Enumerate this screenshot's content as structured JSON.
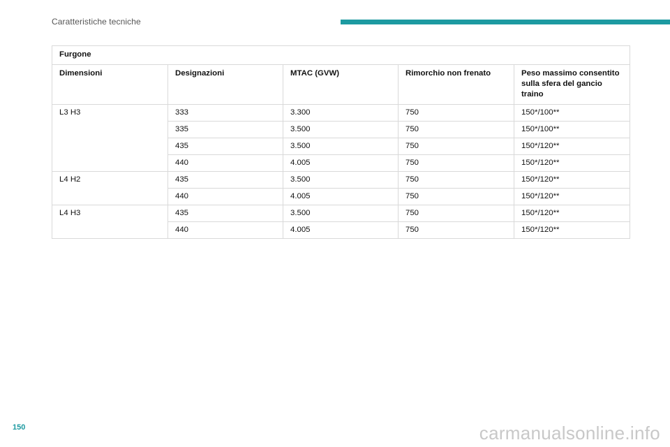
{
  "header": {
    "title": "Caratteristiche tecniche",
    "accent_color": "#1d9aa1"
  },
  "table": {
    "caption": "Furgone",
    "columns": [
      "Dimensioni",
      "Designazioni",
      "MTAC (GVW)",
      "Rimorchio non frenato",
      "Peso massimo consentito sulla sfera del gancio traino"
    ],
    "groups": [
      {
        "dimension": "L3 H3",
        "rows": [
          [
            "333",
            "3.300",
            "750",
            "150*/100**"
          ],
          [
            "335",
            "3.500",
            "750",
            "150*/100**"
          ],
          [
            "435",
            "3.500",
            "750",
            "150*/120**"
          ],
          [
            "440",
            "4.005",
            "750",
            "150*/120**"
          ]
        ]
      },
      {
        "dimension": "L4 H2",
        "rows": [
          [
            "435",
            "3.500",
            "750",
            "150*/120**"
          ],
          [
            "440",
            "4.005",
            "750",
            "150*/120**"
          ]
        ]
      },
      {
        "dimension": "L4 H3",
        "rows": [
          [
            "435",
            "3.500",
            "750",
            "150*/120**"
          ],
          [
            "440",
            "4.005",
            "750",
            "150*/120**"
          ]
        ]
      }
    ]
  },
  "footer": {
    "page_number": "150",
    "watermark": "carmanualsonline.info"
  }
}
